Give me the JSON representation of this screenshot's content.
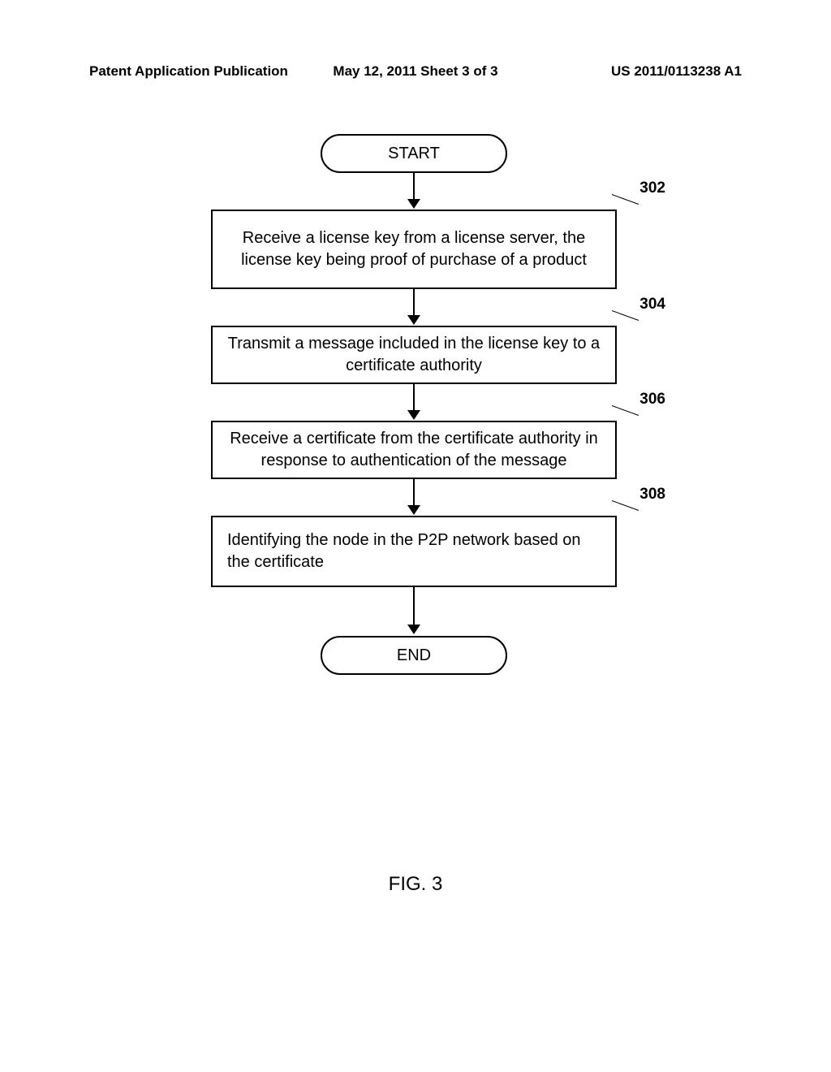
{
  "header": {
    "left": "Patent Application Publication",
    "center": "May 12, 2011  Sheet 3 of 3",
    "right": "US 2011/0113238 A1"
  },
  "flowchart": {
    "start": "START",
    "end": "END",
    "steps": [
      {
        "num": "302",
        "text": "Receive a license key from a license server, the license key being proof of purchase of a product"
      },
      {
        "num": "304",
        "text": "Transmit a message included in the license key to a certificate authority"
      },
      {
        "num": "306",
        "text": "Receive a certificate from the certificate authority in response to authentication of the message"
      },
      {
        "num": "308",
        "text": "Identifying the node in the P2P network based on the certificate"
      }
    ]
  },
  "figure_label": "FIG. 3"
}
